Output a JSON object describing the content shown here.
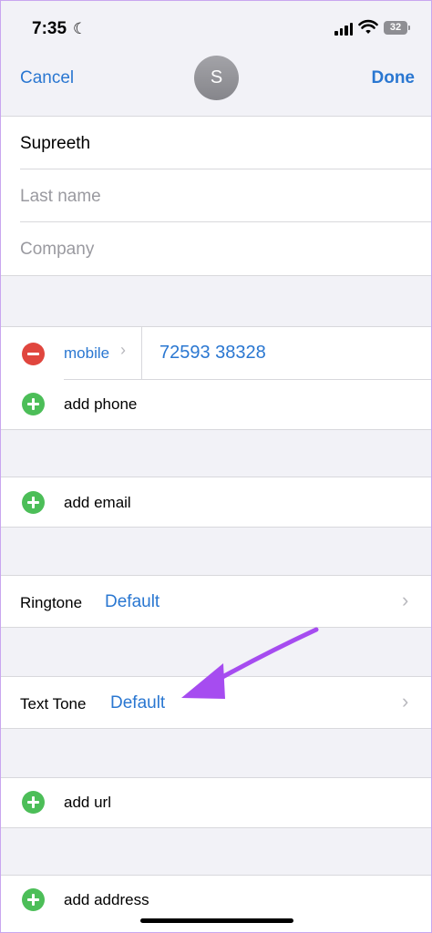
{
  "status": {
    "time": "7:35",
    "battery": "32"
  },
  "nav": {
    "cancel": "Cancel",
    "done": "Done",
    "avatar_initial": "S"
  },
  "name": {
    "first": "Supreeth",
    "last_placeholder": "Last name",
    "company_placeholder": "Company"
  },
  "phone": {
    "label": "mobile",
    "number": "72593 38328",
    "add": "add phone"
  },
  "email": {
    "add": "add email"
  },
  "ringtone": {
    "label": "Ringtone",
    "value": "Default"
  },
  "texttone": {
    "label": "Text Tone",
    "value": "Default"
  },
  "url": {
    "add": "add url"
  },
  "address": {
    "add": "add address"
  },
  "colors": {
    "accent": "#2a77d1",
    "delete": "#e0463e",
    "add": "#4cbe58",
    "annotation_arrow": "#a64cf0"
  }
}
